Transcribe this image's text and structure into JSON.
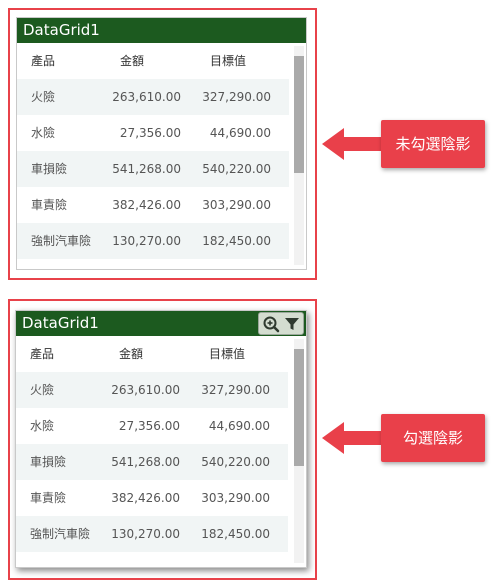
{
  "panels": [
    {
      "title": "DataGrid1",
      "columns": [
        "產品",
        "金額",
        "目標值"
      ],
      "rows": [
        [
          "火險",
          "263,610.00",
          "327,290.00"
        ],
        [
          "水險",
          "27,356.00",
          "44,690.00"
        ],
        [
          "車損險",
          "541,268.00",
          "540,220.00"
        ],
        [
          "車責險",
          "382,426.00",
          "303,290.00"
        ],
        [
          "強制汽車險",
          "130,270.00",
          "182,450.00"
        ]
      ],
      "callout": "未勾選陰影"
    },
    {
      "title": "DataGrid1",
      "columns": [
        "產品",
        "金額",
        "目標值"
      ],
      "rows": [
        [
          "火險",
          "263,610.00",
          "327,290.00"
        ],
        [
          "水險",
          "27,356.00",
          "44,690.00"
        ],
        [
          "車損險",
          "541,268.00",
          "540,220.00"
        ],
        [
          "車責險",
          "382,426.00",
          "303,290.00"
        ],
        [
          "強制汽車險",
          "130,270.00",
          "182,450.00"
        ]
      ],
      "callout": "勾選陰影"
    }
  ],
  "icons": {
    "zoom": "zoom-in-icon",
    "filter": "filter-icon",
    "arrow": "left-arrow-icon"
  },
  "colors": {
    "title_bar": "#1c5a1f",
    "highlight_border": "#e8424a",
    "callout": "#e9404a",
    "alt_row": "#f1f5f5"
  }
}
